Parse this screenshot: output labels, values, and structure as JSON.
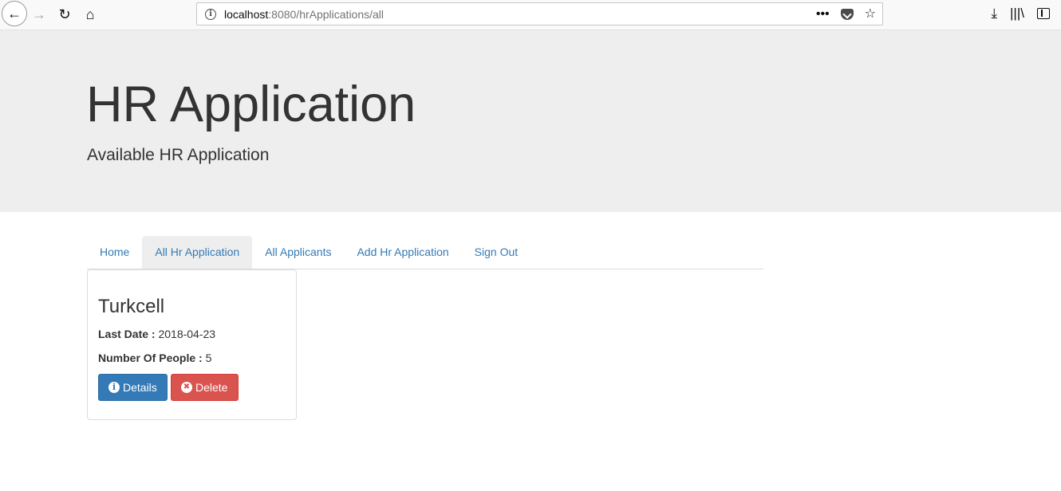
{
  "browser": {
    "back_icon": "←",
    "forward_icon": "→",
    "reload_icon": "↻",
    "home_icon": "⌂",
    "url_host": "localhost",
    "url_path": ":8080/hrApplications/all",
    "more_icon": "•••",
    "star_icon": "☆",
    "download_icon": "⤓",
    "library_icon": "|||\\"
  },
  "header": {
    "title": "HR Application",
    "subtitle": "Available HR Application"
  },
  "tabs": [
    {
      "label": "Home",
      "active": false
    },
    {
      "label": "All Hr Application",
      "active": true
    },
    {
      "label": "All Applicants",
      "active": false
    },
    {
      "label": "Add Hr Application",
      "active": false
    },
    {
      "label": "Sign Out",
      "active": false
    }
  ],
  "applications": [
    {
      "name": "Turkcell",
      "last_date_label": "Last Date :",
      "last_date": "2018-04-23",
      "people_label": "Number Of People :",
      "people": "5",
      "details_label": "Details",
      "delete_label": "Delete"
    }
  ],
  "colors": {
    "primary": "#337ab7",
    "danger": "#d9534f",
    "jumbotron_bg": "#eeeeee"
  }
}
